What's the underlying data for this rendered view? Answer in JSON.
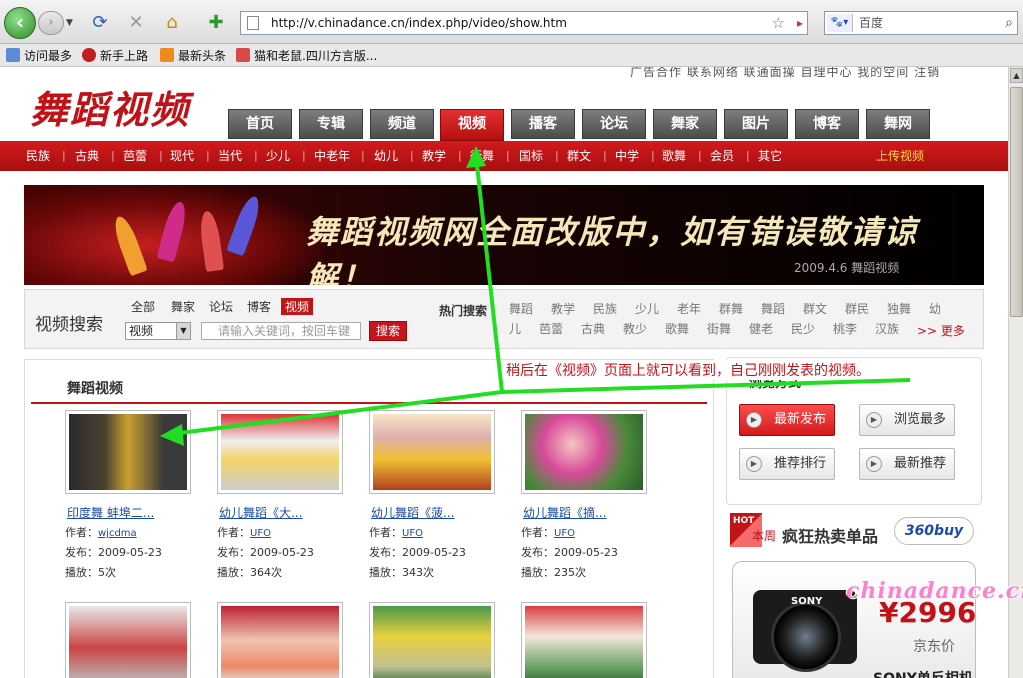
{
  "browser": {
    "url": "http://v.chinadance.cn/index.php/video/show.htm",
    "search_placeholder": "百度",
    "bookmarks": [
      "访问最多",
      "新手上路",
      "最新头条",
      "猫和老鼠.四川方言版..."
    ]
  },
  "site": {
    "toplinks": "广告合作  联系网络  联通面操    自理中心    我的空间    注销",
    "logo": "舞蹈视频",
    "main_nav": [
      "首页",
      "专辑",
      "频道",
      "视频",
      "播客",
      "论坛",
      "舞家",
      "图片",
      "博客",
      "舞网"
    ],
    "active_tab": "视频",
    "categories": [
      "民族",
      "古典",
      "芭蕾",
      "现代",
      "当代",
      "少儿",
      "中老年",
      "幼儿",
      "教学",
      "街舞",
      "国标",
      "群文",
      "中学",
      "歌舞",
      "会员",
      "其它"
    ],
    "upload": "上传视频"
  },
  "banner": {
    "text": "舞蹈视频网全面改版中，如有错误敬请谅解！",
    "date": "2009.4.6 舞蹈视频"
  },
  "search": {
    "title": "视频搜索",
    "tabs": [
      "全部",
      "舞家",
      "论坛",
      "博客",
      "视频"
    ],
    "select_value": "视频",
    "input_placeholder": "请输入关键词，按回车键",
    "button": "搜索",
    "hot_label": "热门搜索",
    "hot_row1": [
      "舞蹈",
      "教学",
      "民族",
      "少儿",
      "老年",
      "群舞",
      "舞蹈",
      "群文",
      "群民",
      "独舞",
      "幼"
    ],
    "hot_row2": [
      "儿",
      "芭蕾",
      "古典",
      "教少",
      "歌舞",
      "街舞",
      "健老",
      "民少",
      "桃李",
      "汉族"
    ],
    "more": ">> 更多"
  },
  "videos": {
    "section_title": "舞蹈视频",
    "items": [
      {
        "title": "印度舞 蚌埠二...",
        "author_label": "作者：",
        "author": "wjcdma",
        "date": "发布：2009-05-23",
        "plays": "播放：5次"
      },
      {
        "title": "幼儿舞蹈《大...",
        "author_label": "作者：",
        "author": "UFO",
        "date": "发布：2009-05-23",
        "plays": "播放：364次"
      },
      {
        "title": "幼儿舞蹈《菠...",
        "author_label": "作者：",
        "author": "UFO",
        "date": "发布：2009-05-23",
        "plays": "播放：343次"
      },
      {
        "title": "幼儿舞蹈《摘...",
        "author_label": "作者：",
        "author": "UFO",
        "date": "发布：2009-05-23",
        "plays": "播放：235次"
      }
    ]
  },
  "browse": {
    "title": "浏览方式",
    "buttons": [
      "最新发布",
      "浏览最多",
      "推荐排行",
      "最新推荐"
    ]
  },
  "ad": {
    "hot": "HOT",
    "local": "本周",
    "headline": "疯狂热卖单品",
    "logo": "360buy",
    "camera_brand": "SONY",
    "price": "¥2996",
    "price_label": "京东价",
    "product": "SONY单反相机"
  },
  "annotation": {
    "caption": "稍后在《视频》页面上就可以看到，自己刚刚发表的视频。",
    "watermark": "chinadance.cn"
  },
  "colors": {
    "brand_red": "#c21416",
    "arrow_green": "#22dd22",
    "link_blue": "#1b4ba8"
  }
}
